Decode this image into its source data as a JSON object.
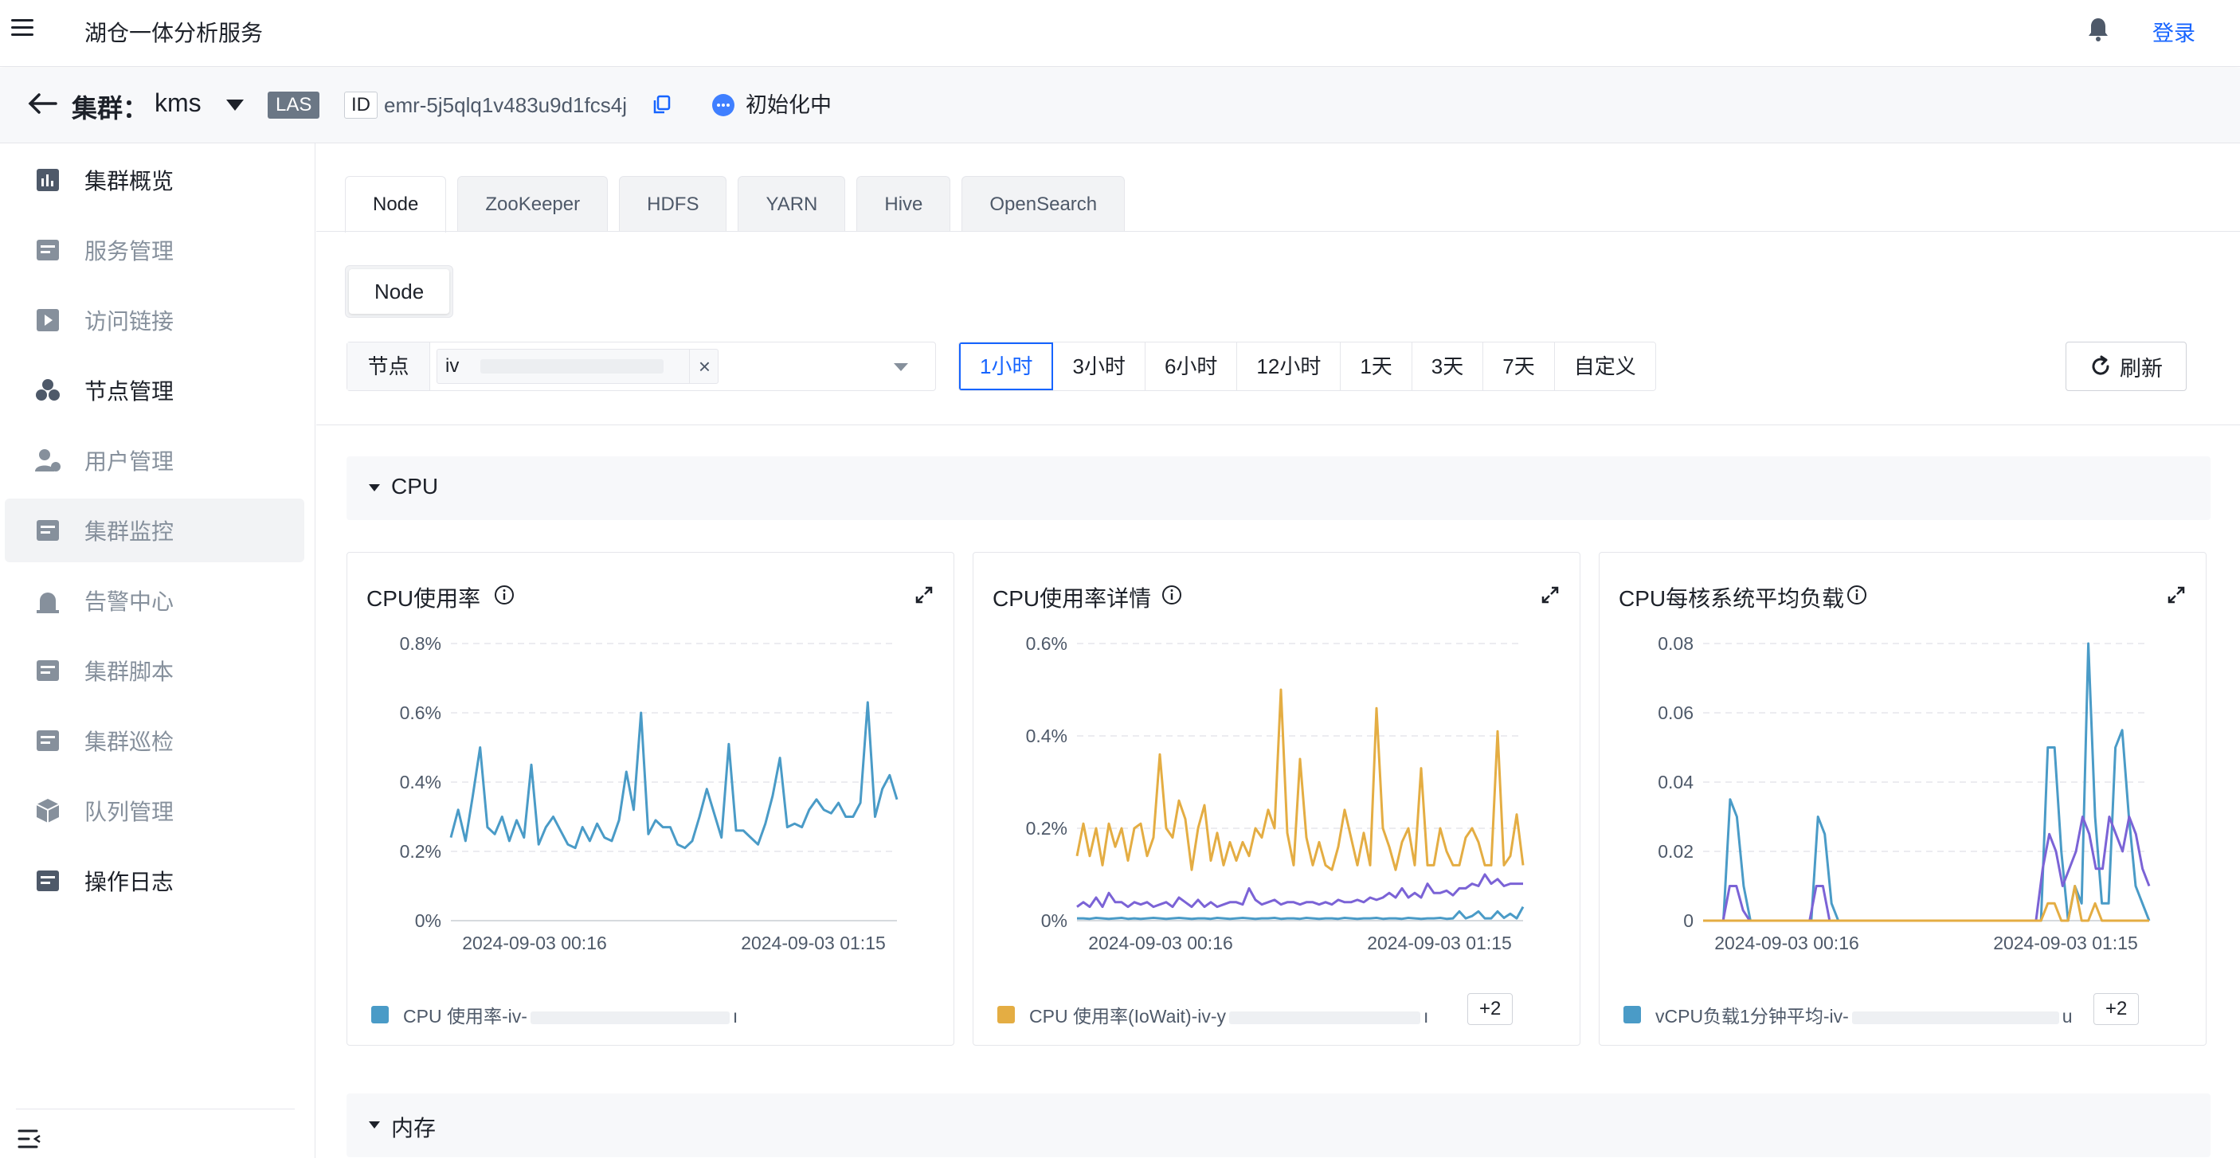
{
  "app": {
    "title": "湖仓一体分析服务",
    "login": "登录"
  },
  "cluster": {
    "label": "集群：",
    "name": "kms",
    "badge": "LAS",
    "id_label": "ID",
    "id": "emr-5j5qlq1v483u9d1fcs4j",
    "status": "初始化中"
  },
  "sidebar": {
    "items": [
      {
        "label": "集群概览",
        "icon": "bar-chart-icon",
        "muted": false,
        "active": false
      },
      {
        "label": "服务管理",
        "icon": "services-icon",
        "muted": true,
        "active": false
      },
      {
        "label": "访问链接",
        "icon": "link-icon",
        "muted": true,
        "active": false
      },
      {
        "label": "节点管理",
        "icon": "nodes-icon",
        "muted": false,
        "active": false
      },
      {
        "label": "用户管理",
        "icon": "user-settings-icon",
        "muted": true,
        "active": false
      },
      {
        "label": "集群监控",
        "icon": "monitor-icon",
        "muted": true,
        "active": true
      },
      {
        "label": "告警中心",
        "icon": "alarm-icon",
        "muted": true,
        "active": false
      },
      {
        "label": "集群脚本",
        "icon": "script-icon",
        "muted": true,
        "active": false
      },
      {
        "label": "集群巡检",
        "icon": "inspection-icon",
        "muted": true,
        "active": false
      },
      {
        "label": "队列管理",
        "icon": "queue-icon",
        "muted": true,
        "active": false
      },
      {
        "label": "操作日志",
        "icon": "log-icon",
        "muted": false,
        "active": false
      }
    ]
  },
  "tabs": [
    "Node",
    "ZooKeeper",
    "HDFS",
    "YARN",
    "Hive",
    "OpenSearch"
  ],
  "subtab": "Node",
  "filter": {
    "label": "节点",
    "value_prefix": "iv",
    "clear": "×"
  },
  "time_range": {
    "options": [
      "1小时",
      "3小时",
      "6小时",
      "12小时",
      "1天",
      "3天",
      "7天",
      "自定义"
    ],
    "selected": "1小时"
  },
  "refresh": "刷新",
  "sections": {
    "cpu": "CPU",
    "memory": "内存"
  },
  "colors": {
    "blue": "#4a9bc7",
    "orange": "#e4ad43",
    "purple": "#7b63d6",
    "accent": "#1664ff"
  },
  "chart_data": [
    {
      "type": "line",
      "title": "CPU使用率",
      "x_ticks": [
        "2024-09-03 00:16",
        "2024-09-03 01:15"
      ],
      "y_ticks": [
        "0.8%",
        "0.6%",
        "0.4%",
        "0.2%",
        "0%"
      ],
      "ylim": [
        0,
        0.8
      ],
      "legend": {
        "prefix": "CPU 使用率-iv-",
        "suffix": "ı",
        "more": ""
      },
      "series": [
        {
          "color": "#4a9bc7",
          "values": [
            0.24,
            0.32,
            0.23,
            0.36,
            0.5,
            0.27,
            0.25,
            0.3,
            0.23,
            0.29,
            0.24,
            0.45,
            0.22,
            0.27,
            0.3,
            0.26,
            0.22,
            0.21,
            0.27,
            0.23,
            0.28,
            0.24,
            0.23,
            0.29,
            0.43,
            0.32,
            0.6,
            0.25,
            0.29,
            0.27,
            0.27,
            0.22,
            0.21,
            0.23,
            0.3,
            0.38,
            0.31,
            0.24,
            0.51,
            0.26,
            0.26,
            0.24,
            0.22,
            0.28,
            0.36,
            0.47,
            0.27,
            0.28,
            0.27,
            0.32,
            0.35,
            0.32,
            0.31,
            0.34,
            0.3,
            0.3,
            0.34,
            0.63,
            0.3,
            0.38,
            0.42,
            0.35
          ]
        }
      ]
    },
    {
      "type": "line",
      "title": "CPU使用率详情",
      "x_ticks": [
        "2024-09-03 00:16",
        "2024-09-03 01:15"
      ],
      "y_ticks": [
        "0.6%",
        "0.4%",
        "0.2%",
        "0%"
      ],
      "ylim": [
        0,
        0.6
      ],
      "legend": {
        "prefix": "CPU 使用率(IoWait)-iv-y",
        "suffix": "ı",
        "more": "+2"
      },
      "series": [
        {
          "color": "#e4ad43",
          "values": [
            0.14,
            0.21,
            0.14,
            0.2,
            0.12,
            0.21,
            0.16,
            0.2,
            0.13,
            0.2,
            0.21,
            0.14,
            0.18,
            0.36,
            0.2,
            0.18,
            0.26,
            0.22,
            0.11,
            0.2,
            0.25,
            0.13,
            0.19,
            0.12,
            0.17,
            0.13,
            0.17,
            0.14,
            0.2,
            0.18,
            0.24,
            0.2,
            0.5,
            0.19,
            0.12,
            0.35,
            0.18,
            0.12,
            0.17,
            0.12,
            0.11,
            0.16,
            0.24,
            0.18,
            0.12,
            0.19,
            0.12,
            0.46,
            0.2,
            0.16,
            0.11,
            0.17,
            0.2,
            0.12,
            0.33,
            0.12,
            0.12,
            0.2,
            0.15,
            0.12,
            0.12,
            0.18,
            0.2,
            0.17,
            0.12,
            0.12,
            0.41,
            0.12,
            0.14,
            0.23,
            0.12
          ]
        },
        {
          "color": "#7b63d6",
          "values": [
            0.03,
            0.04,
            0.03,
            0.05,
            0.03,
            0.06,
            0.04,
            0.04,
            0.03,
            0.04,
            0.035,
            0.04,
            0.03,
            0.035,
            0.04,
            0.03,
            0.05,
            0.04,
            0.03,
            0.045,
            0.03,
            0.04,
            0.03,
            0.035,
            0.04,
            0.04,
            0.035,
            0.07,
            0.045,
            0.035,
            0.04,
            0.045,
            0.035,
            0.04,
            0.04,
            0.035,
            0.04,
            0.04,
            0.035,
            0.04,
            0.035,
            0.045,
            0.04,
            0.04,
            0.045,
            0.04,
            0.05,
            0.045,
            0.05,
            0.06,
            0.05,
            0.07,
            0.05,
            0.06,
            0.05,
            0.08,
            0.06,
            0.06,
            0.065,
            0.055,
            0.07,
            0.07,
            0.08,
            0.075,
            0.1,
            0.08,
            0.09,
            0.075,
            0.08,
            0.08,
            0.08
          ]
        },
        {
          "color": "#4a9bc7",
          "values": [
            0.005,
            0.005,
            0.004,
            0.006,
            0.005,
            0.004,
            0.005,
            0.006,
            0.004,
            0.005,
            0.004,
            0.005,
            0.006,
            0.005,
            0.004,
            0.005,
            0.006,
            0.005,
            0.004,
            0.005,
            0.005,
            0.004,
            0.006,
            0.005,
            0.004,
            0.005,
            0.006,
            0.005,
            0.004,
            0.005,
            0.005,
            0.006,
            0.004,
            0.005,
            0.005,
            0.004,
            0.006,
            0.005,
            0.004,
            0.005,
            0.005,
            0.004,
            0.006,
            0.005,
            0.004,
            0.005,
            0.005,
            0.006,
            0.004,
            0.005,
            0.005,
            0.004,
            0.006,
            0.005,
            0.004,
            0.005,
            0.005,
            0.006,
            0.004,
            0.005,
            0.02,
            0.005,
            0.01,
            0.02,
            0.005,
            0.005,
            0.02,
            0.006,
            0.015,
            0.005,
            0.03
          ]
        }
      ]
    },
    {
      "type": "line",
      "title": "CPU每核系统平均负载",
      "x_ticks": [
        "2024-09-03 00:16",
        "2024-09-03 01:15"
      ],
      "y_ticks": [
        "0.08",
        "0.06",
        "0.04",
        "0.02",
        "0"
      ],
      "ylim": [
        0,
        0.08
      ],
      "legend": {
        "prefix": "vCPU负载1分钟平均-iv-",
        "suffix": "u",
        "more": "+2"
      },
      "series": [
        {
          "color": "#4a9bc7",
          "values": [
            0,
            0,
            0,
            0,
            0.035,
            0.03,
            0.01,
            0,
            0,
            0,
            0,
            0,
            0,
            0,
            0,
            0,
            0,
            0.03,
            0.025,
            0.005,
            0,
            0,
            0,
            0,
            0,
            0,
            0,
            0,
            0,
            0,
            0,
            0,
            0,
            0,
            0,
            0,
            0,
            0,
            0,
            0,
            0,
            0,
            0,
            0,
            0,
            0,
            0,
            0,
            0,
            0,
            0,
            0.05,
            0.05,
            0.02,
            0,
            0.01,
            0.005,
            0.08,
            0.03,
            0.005,
            0.005,
            0.05,
            0.055,
            0.03,
            0.01,
            0.005,
            0
          ]
        },
        {
          "color": "#7b63d6",
          "values": [
            0,
            0,
            0,
            0,
            0.01,
            0.01,
            0.003,
            0,
            0,
            0,
            0,
            0,
            0,
            0,
            0,
            0,
            0,
            0.01,
            0.01,
            0,
            0,
            0,
            0,
            0,
            0,
            0,
            0,
            0,
            0,
            0,
            0,
            0,
            0,
            0,
            0,
            0,
            0,
            0,
            0,
            0,
            0,
            0,
            0,
            0,
            0,
            0,
            0,
            0,
            0,
            0,
            0,
            0.015,
            0.025,
            0.02,
            0.01,
            0.015,
            0.02,
            0.03,
            0.025,
            0.015,
            0.015,
            0.03,
            0.025,
            0.02,
            0.03,
            0.025,
            0.015,
            0.01
          ]
        },
        {
          "color": "#e4ad43",
          "values": [
            0,
            0,
            0,
            0,
            0,
            0,
            0,
            0,
            0,
            0,
            0,
            0,
            0,
            0,
            0,
            0,
            0,
            0,
            0,
            0,
            0,
            0,
            0,
            0,
            0,
            0,
            0,
            0,
            0,
            0,
            0,
            0,
            0,
            0,
            0,
            0,
            0,
            0,
            0,
            0,
            0,
            0,
            0,
            0,
            0,
            0,
            0,
            0,
            0,
            0,
            0,
            0.005,
            0.005,
            0,
            0,
            0.01,
            0,
            0,
            0.005,
            0,
            0,
            0,
            0,
            0,
            0,
            0,
            0
          ]
        }
      ]
    }
  ]
}
